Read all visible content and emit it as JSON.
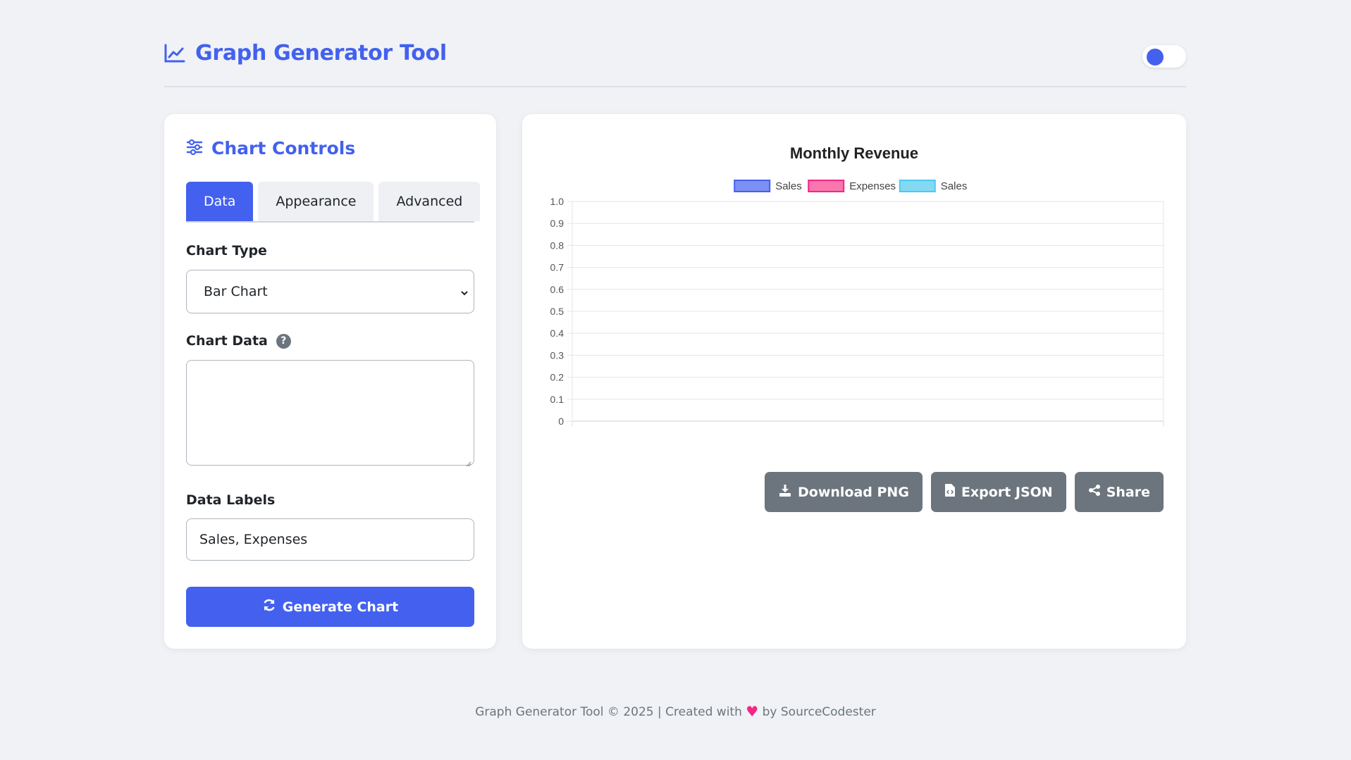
{
  "header": {
    "title": "Graph Generator Tool",
    "theme_toggle_on": true
  },
  "controls": {
    "title": "Chart Controls",
    "tabs": [
      {
        "label": "Data",
        "active": true
      },
      {
        "label": "Appearance",
        "active": false
      },
      {
        "label": "Advanced",
        "active": false
      }
    ],
    "chart_type_label": "Chart Type",
    "chart_type_value": "Bar Chart",
    "chart_data_label": "Chart Data",
    "chart_data_value": "",
    "data_labels_label": "Data Labels",
    "data_labels_value": "Sales, Expenses",
    "generate_label": "Generate Chart"
  },
  "chart_data": {
    "type": "bar",
    "title": "Monthly Revenue",
    "categories": [],
    "series": [
      {
        "name": "Sales",
        "values": [],
        "color": "#7b8ff5",
        "border": "#4361ee"
      },
      {
        "name": "Expenses",
        "values": [],
        "color": "#f777ae",
        "border": "#f72585"
      },
      {
        "name": "Sales",
        "values": [],
        "color": "#84d9f2",
        "border": "#4cc9f0"
      }
    ],
    "ylim": [
      0,
      1.0
    ],
    "yticks": [
      "1.0",
      "0.9",
      "0.8",
      "0.7",
      "0.6",
      "0.5",
      "0.4",
      "0.3",
      "0.2",
      "0.1",
      "0"
    ],
    "grid": true,
    "legend_position": "top"
  },
  "actions": {
    "download_label": "Download PNG",
    "export_label": "Export JSON",
    "share_label": "Share"
  },
  "footer": {
    "prefix": "Graph Generator Tool © 2025 | Created with",
    "suffix": "by SourceCodester"
  },
  "colors": {
    "accent": "#4361ee",
    "secondary": "#6c757d",
    "heart": "#f72585"
  }
}
